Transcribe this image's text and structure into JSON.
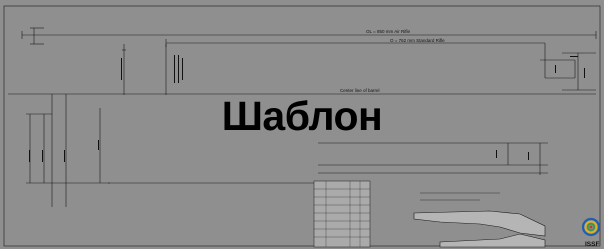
{
  "labels": {
    "ol_air_rifle": "OL = 850 mm Air Rifle",
    "ol_standard_rifle": "O = 762 mm Standard Rifle",
    "center_line": "Center line of barrel"
  },
  "watermark": "Шаблон",
  "logo": {
    "text": "ISSF",
    "ring_colors": [
      "#1f5fb0",
      "#e0b020",
      "#111111",
      "#2f9a3e",
      "#d03030"
    ]
  },
  "colors": {
    "background": "#8f8f8f",
    "line": "#1a1a1a"
  }
}
